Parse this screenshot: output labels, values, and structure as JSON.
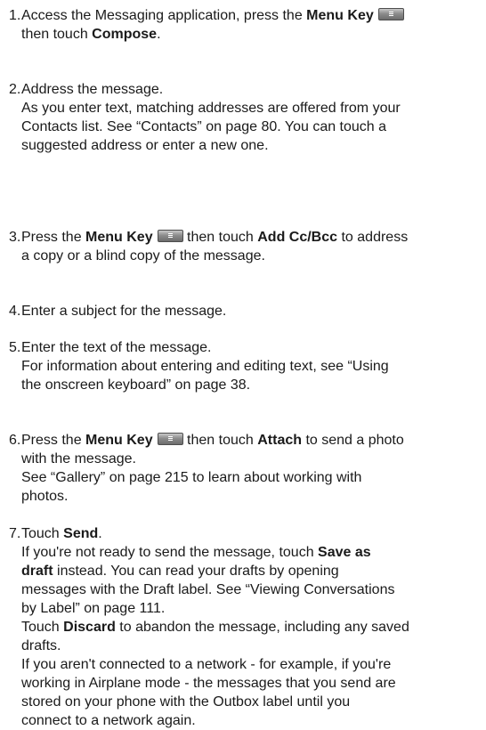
{
  "steps": [
    {
      "number": "1.",
      "lines": [
        [
          {
            "t": "Access the Messaging application, press the "
          },
          {
            "t": "Menu Key",
            "b": true
          },
          {
            "icon": "menu-key-icon"
          }
        ],
        [
          {
            "t": "then touch "
          },
          {
            "t": "Compose",
            "b": true
          },
          {
            "t": "."
          }
        ]
      ]
    },
    {
      "number": "2.",
      "lines": [
        [
          {
            "t": "Address the message."
          }
        ],
        [
          {
            "t": "As you enter text, matching addresses are offered from your"
          }
        ],
        [
          {
            "t": "Contacts list. See “Contacts” on page 80. You can touch a"
          }
        ],
        [
          {
            "t": "suggested address or enter a new one."
          }
        ]
      ]
    },
    {
      "number": "3.",
      "lines": [
        [
          {
            "t": "Press the "
          },
          {
            "t": "Menu Key",
            "b": true
          },
          {
            "icon": "menu-key-icon"
          },
          {
            "t": " then touch "
          },
          {
            "t": "Add Cc/Bcc",
            "b": true
          },
          {
            "t": " to address"
          }
        ],
        [
          {
            "t": "a copy or a blind copy of the message."
          }
        ]
      ]
    },
    {
      "number": "4.",
      "lines": [
        [
          {
            "t": "Enter a subject for the message."
          }
        ]
      ]
    },
    {
      "number": "5.",
      "lines": [
        [
          {
            "t": "Enter the text of the message."
          }
        ],
        [
          {
            "t": "For information about entering and editing text, see “Using"
          }
        ],
        [
          {
            "t": "the onscreen keyboard” on page 38."
          }
        ]
      ]
    },
    {
      "number": "6.",
      "lines": [
        [
          {
            "t": "Press the "
          },
          {
            "t": "Menu Key",
            "b": true
          },
          {
            "icon": "menu-key-icon"
          },
          {
            "t": " then touch "
          },
          {
            "t": "Attach",
            "b": true
          },
          {
            "t": " to send a photo"
          }
        ],
        [
          {
            "t": "with the message."
          }
        ],
        [
          {
            "t": "See “Gallery” on page 215 to learn about working with"
          }
        ],
        [
          {
            "t": "photos."
          }
        ]
      ]
    },
    {
      "number": "7.",
      "lines": [
        [
          {
            "t": "Touch "
          },
          {
            "t": "Send",
            "b": true
          },
          {
            "t": "."
          }
        ],
        [
          {
            "t": "If you're not ready to send the message, touch "
          },
          {
            "t": "Save as",
            "b": true
          }
        ],
        [
          {
            "t": "draft",
            "b": true
          },
          {
            "t": " instead. You can read your drafts by opening"
          }
        ],
        [
          {
            "t": "messages with the Draft label. See “Viewing Conversations"
          }
        ],
        [
          {
            "t": "by Label” on page 111."
          }
        ],
        [
          {
            "t": "Touch "
          },
          {
            "t": "Discard",
            "b": true
          },
          {
            "t": " to abandon the message, including any saved"
          }
        ],
        [
          {
            "t": "drafts."
          }
        ],
        [
          {
            "t": "If you aren't connected to a network - for example, if you're"
          }
        ],
        [
          {
            "t": "working in Airplane mode - the messages that you send are"
          }
        ],
        [
          {
            "t": "stored on your phone with the Outbox label until you"
          }
        ],
        [
          {
            "t": "connect to a network again."
          }
        ]
      ]
    }
  ]
}
